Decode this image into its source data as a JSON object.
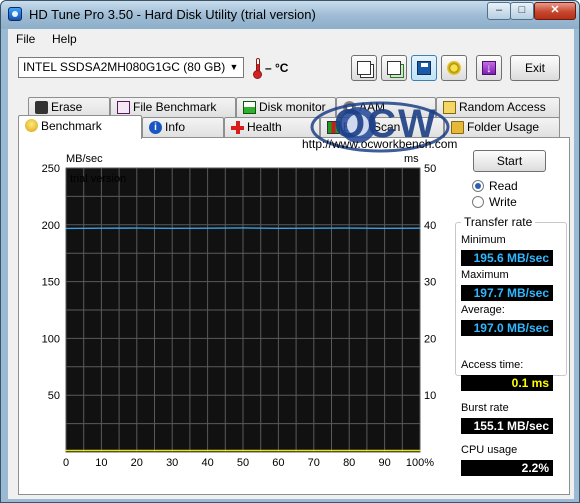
{
  "window": {
    "title": "HD Tune Pro 3.50 - Hard Disk Utility (trial version)"
  },
  "titlebar_buttons": {
    "minimize": "–",
    "maximize": "□",
    "close": "✕"
  },
  "menu": {
    "file": "File",
    "help": "Help"
  },
  "toolbar": {
    "drive": "INTEL SSDSA2MH080G1GC (80 GB)",
    "temperature": "– °C",
    "exit_label": "Exit",
    "exit_down_glyph": "↓"
  },
  "tabs_row1": [
    "Erase",
    "File Benchmark",
    "Disk monitor",
    "AAM",
    "Random Access"
  ],
  "tabs_row2": [
    "Benchmark",
    "Info",
    "Health",
    "Error Scan",
    "Folder Usage"
  ],
  "active_tab": "Benchmark",
  "watermark": {
    "url": "http://www.ocworkbench.com",
    "logo_text": "OCW"
  },
  "controls": {
    "start_label": "Start",
    "read_label": "Read",
    "write_label": "Write",
    "selected_mode": "Read"
  },
  "stats": {
    "transfer_rate_title": "Transfer rate",
    "minimum_label": "Minimum",
    "minimum_value": "195.6 MB/sec",
    "maximum_label": "Maximum",
    "maximum_value": "197.7 MB/sec",
    "average_label": "Average:",
    "average_value": "197.0 MB/sec",
    "access_time_label": "Access time:",
    "access_time_value": "0.1 ms",
    "burst_rate_label": "Burst rate",
    "burst_rate_value": "155.1 MB/sec",
    "cpu_usage_label": "CPU usage",
    "cpu_usage_value": "2.2%"
  },
  "chart_data": {
    "type": "line",
    "annotation": "trial version",
    "ylabel": "MB/sec",
    "y2label": "ms",
    "ylim": [
      0,
      250
    ],
    "y2lim": [
      0,
      50
    ],
    "yticks": [
      250,
      200,
      150,
      100,
      50
    ],
    "y2ticks": [
      50,
      40,
      30,
      20,
      10
    ],
    "xticks": [
      "0",
      "10",
      "20",
      "30",
      "40",
      "50",
      "60",
      "70",
      "80",
      "90",
      "100%"
    ],
    "grid": true,
    "series": [
      {
        "color": "#3aa0e6",
        "x": [
          0,
          10,
          20,
          30,
          40,
          50,
          60,
          70,
          80,
          90,
          100
        ],
        "values": [
          196.8,
          197.0,
          197.1,
          196.9,
          197.0,
          197.2,
          196.9,
          197.0,
          197.1,
          196.9,
          197.0
        ]
      },
      {
        "color": "#e6e600",
        "x": [
          0,
          10,
          20,
          30,
          40,
          50,
          60,
          70,
          80,
          90,
          100
        ],
        "values": [
          0.1,
          0.1,
          0.1,
          0.1,
          0.1,
          0.1,
          0.1,
          0.1,
          0.1,
          0.1,
          0.1
        ]
      }
    ]
  }
}
